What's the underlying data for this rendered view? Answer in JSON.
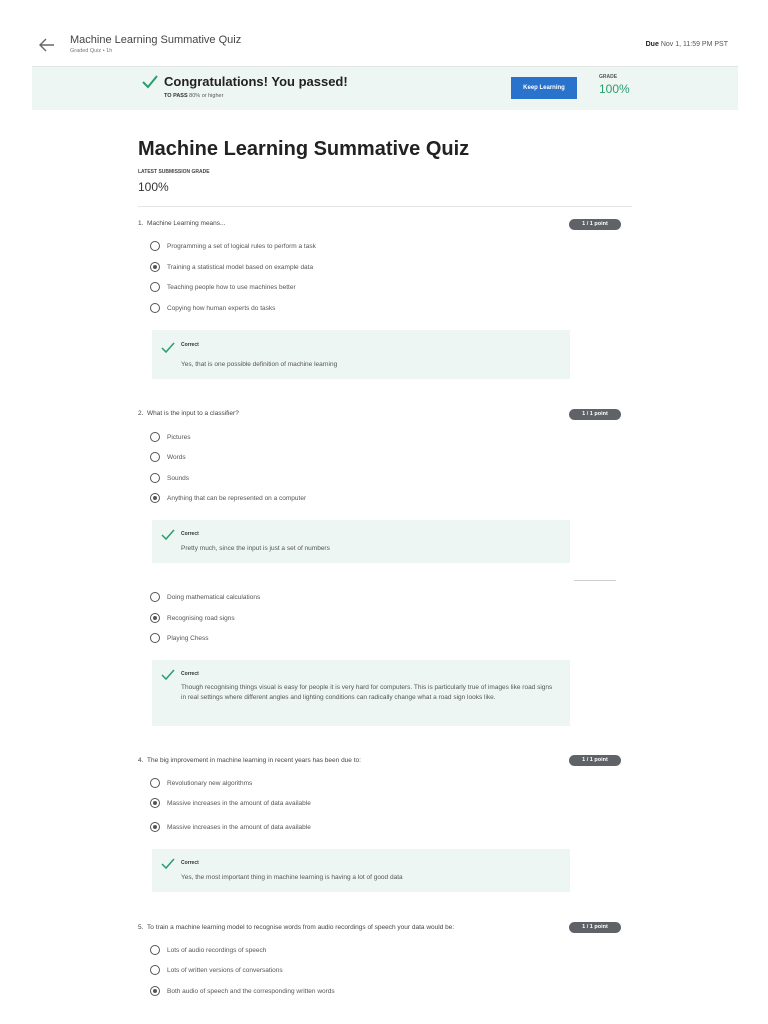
{
  "header": {
    "title": "Machine Learning Summative Quiz",
    "subtitle": "Graded Quiz • 1h",
    "due_label": "Due",
    "due_value": "Nov 1, 11:59 PM PST"
  },
  "banner": {
    "message": "Congratulations! You passed!",
    "to_pass_label": "TO PASS",
    "to_pass_value": "80% or higher",
    "keep_learning_label": "Keep Learning",
    "grade_label": "GRADE",
    "grade_value": "100%"
  },
  "quiz": {
    "title": "Machine Learning Summative Quiz",
    "latest_label": "LATEST SUBMISSION GRADE",
    "latest_value": "100%"
  },
  "questions": [
    {
      "number": "1.",
      "text": "Machine Learning means...",
      "points": "1 / 1 point",
      "options": [
        {
          "label": "Programming a set of logical rules to perform a task",
          "selected": false
        },
        {
          "label": "Training a statistical model based on example data",
          "selected": true
        },
        {
          "label": "Teaching people how to use machines better",
          "selected": false
        },
        {
          "label": "Copying how human experts do tasks",
          "selected": false
        }
      ],
      "feedback": {
        "status": "Correct",
        "text": "Yes, that is one possible definition of machine learning"
      }
    },
    {
      "number": "2.",
      "text": "What is the input to a classifier?",
      "points": "1 / 1 point",
      "options": [
        {
          "label": "Pictures",
          "selected": false
        },
        {
          "label": "Words",
          "selected": false
        },
        {
          "label": "Sounds",
          "selected": false
        },
        {
          "label": "Anything that can be represented on a computer",
          "selected": true
        }
      ],
      "feedback": {
        "status": "Correct",
        "text": "Pretty much, since the input is just a set of numbers"
      }
    },
    {
      "options": [
        {
          "label": "Doing mathematical calculations",
          "selected": false
        },
        {
          "label": "Recognising road signs",
          "selected": true
        },
        {
          "label": "Playing Chess",
          "selected": false
        }
      ],
      "feedback": {
        "status": "Correct",
        "text": "Though recognising things visual is easy for people it is very hard for computers. This is particularly true of images like road signs in real settings where different angles and lighting conditions can radically change what a road sign looks like."
      }
    },
    {
      "number": "4.",
      "text": "The big improvement in machine learning in recent years has been due to:",
      "points": "1 / 1 point",
      "options": [
        {
          "label": "Revolutionary new algorithms",
          "selected": false
        },
        {
          "label": "Massive increases in the amount of data available",
          "selected": true
        },
        {
          "label": "Massive increases in the amount of data available",
          "selected": true
        }
      ],
      "feedback": {
        "status": "Correct",
        "text": "Yes, the most important thing in machine learning is having a lot of good data"
      }
    },
    {
      "number": "5.",
      "text": "To train a machine learning model to recognise words from audio recordings of speech your data would be:",
      "points": "1 / 1 point",
      "options": [
        {
          "label": "Lots of audio recordings of speech",
          "selected": false
        },
        {
          "label": "Lots of written versions of conversations",
          "selected": false
        },
        {
          "label": "Both audio of speech and the corresponding written words",
          "selected": true
        }
      ]
    }
  ],
  "colors": {
    "accent_blue": "#2a73cc",
    "success_green": "#2a9d6f",
    "feedback_bg": "#eef6f3",
    "pill_bg": "#5f6368"
  }
}
